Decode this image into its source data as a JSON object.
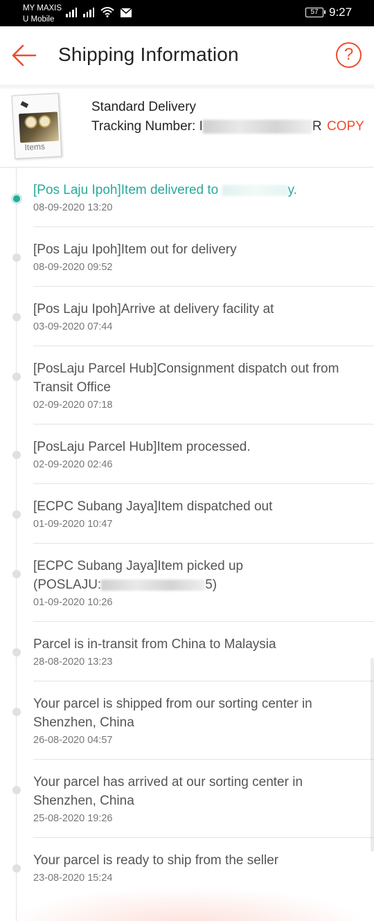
{
  "status_bar": {
    "carrier_line1": "MY MAXIS",
    "carrier_line2": "U Mobile",
    "battery": "57",
    "time": "9:27"
  },
  "header": {
    "title": "Shipping Information",
    "back_icon": "arrow-left-icon",
    "help_icon": "question-mark-icon",
    "help_label": "?"
  },
  "package": {
    "thumbnail_label": "Items",
    "delivery_type": "Standard Delivery",
    "tracking_label": "Tracking Number:",
    "tracking_number_prefix": "I",
    "tracking_number_suffix": "R",
    "copy_label": "COPY"
  },
  "colors": {
    "accent": "#ee4d2d",
    "active": "#26aa99"
  },
  "events": [
    {
      "description": "[Pos Laju Ipoh]Item delivered to",
      "description_tail": "y.",
      "time": "08-09-2020 13:20",
      "active": true
    },
    {
      "description": "[Pos Laju Ipoh]Item out for delivery",
      "time": "08-09-2020 09:52"
    },
    {
      "description": "[Pos Laju Ipoh]Arrive at delivery facility at",
      "time": "03-09-2020 07:44"
    },
    {
      "description": "[PosLaju Parcel Hub]Consignment dispatch out from Transit Office",
      "time": "02-09-2020 07:18"
    },
    {
      "description": "[PosLaju Parcel Hub]Item processed.",
      "time": "02-09-2020 02:46"
    },
    {
      "description": "[ECPC Subang Jaya]Item dispatched out",
      "time": "01-09-2020 10:47"
    },
    {
      "description": "[ECPC Subang Jaya]Item picked up",
      "description_line2_prefix": "(POSLAJU:",
      "description_line2_suffix": "5)",
      "time": "01-09-2020 10:26"
    },
    {
      "description": "Parcel is in-transit from China to Malaysia",
      "time": "28-08-2020 13:23"
    },
    {
      "description": "Your parcel is shipped from our sorting center in Shenzhen, China",
      "time": "26-08-2020 04:57"
    },
    {
      "description": "Your parcel has arrived at our sorting center in Shenzhen, China",
      "time": "25-08-2020 19:26"
    },
    {
      "description": "Your parcel is ready to ship from the seller",
      "time": "23-08-2020 15:24"
    }
  ]
}
